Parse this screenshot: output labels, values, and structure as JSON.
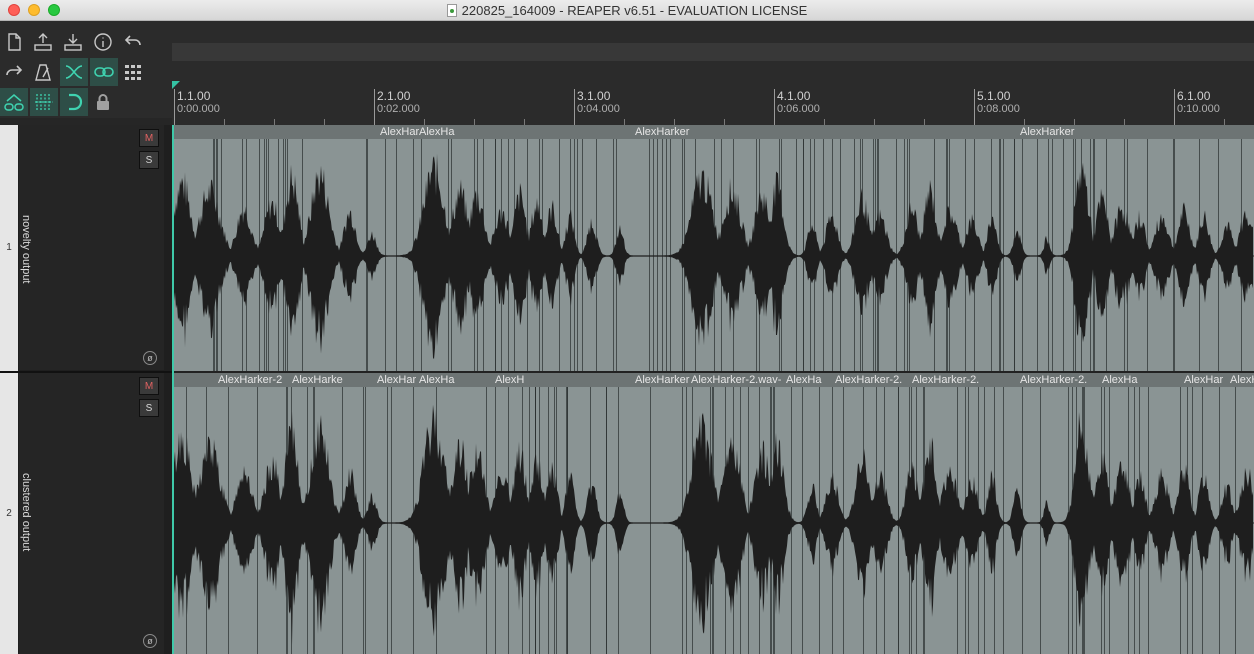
{
  "window": {
    "title": "220825_164009 - REAPER v6.51 - EVALUATION LICENSE"
  },
  "toolbar": {
    "buttons": [
      {
        "name": "new-project-icon",
        "active": false
      },
      {
        "name": "upload-icon",
        "active": false
      },
      {
        "name": "download-icon",
        "active": false
      },
      {
        "name": "info-icon",
        "active": false
      },
      {
        "name": "undo-icon",
        "active": false
      },
      {
        "name": "redo-icon",
        "active": false
      },
      {
        "name": "metronome-icon",
        "active": false
      },
      {
        "name": "crossfade-icon",
        "active": true
      },
      {
        "name": "link-icon",
        "active": true
      },
      {
        "name": "grid-icon",
        "active": false
      },
      {
        "name": "ripple-icon",
        "active": true
      },
      {
        "name": "snap-grid-icon",
        "active": true
      },
      {
        "name": "magnet-icon",
        "active": true
      },
      {
        "name": "lock-icon",
        "active": false
      }
    ]
  },
  "ruler": {
    "marks": [
      {
        "bar": "1.1.00",
        "time": "0:00.000"
      },
      {
        "bar": "2.1.00",
        "time": "0:02.000"
      },
      {
        "bar": "3.1.00",
        "time": "0:04.000"
      },
      {
        "bar": "4.1.00",
        "time": "0:06.000"
      },
      {
        "bar": "5.1.00",
        "time": "0:08.000"
      },
      {
        "bar": "6.1.00",
        "time": "0:10.000"
      }
    ]
  },
  "tracks": [
    {
      "number": "1",
      "name": "novelty output",
      "mute_label": "M",
      "solo_label": "S",
      "phase_label": "ø",
      "items": [
        {
          "label": "AlexHar"
        },
        {
          "label": "AlexHa"
        },
        {
          "label": "AlexHarker"
        },
        {
          "label": "AlexHarker"
        }
      ]
    },
    {
      "number": "2",
      "name": "clustered output",
      "mute_label": "M",
      "solo_label": "S",
      "phase_label": "ø",
      "items": [
        {
          "label": "AlexHarker-2"
        },
        {
          "label": "AlexHarke"
        },
        {
          "label": "AlexHar"
        },
        {
          "label": "AlexHa"
        },
        {
          "label": "AlexH"
        },
        {
          "label": "AlexHarker"
        },
        {
          "label": "AlexHarker-2.wav-"
        },
        {
          "label": "AlexHa"
        },
        {
          "label": "AlexHarker-2."
        },
        {
          "label": "AlexHarker-2."
        },
        {
          "label": "AlexHarker-2."
        },
        {
          "label": "AlexHa"
        },
        {
          "label": "AlexHar"
        },
        {
          "label": "AlexH"
        }
      ]
    }
  ],
  "colors": {
    "accent": "#3fd3b0",
    "item_body": "#8a9494",
    "item_header": "#6d7474",
    "waveform": "#1e1e1e",
    "mute": "#e06262"
  }
}
